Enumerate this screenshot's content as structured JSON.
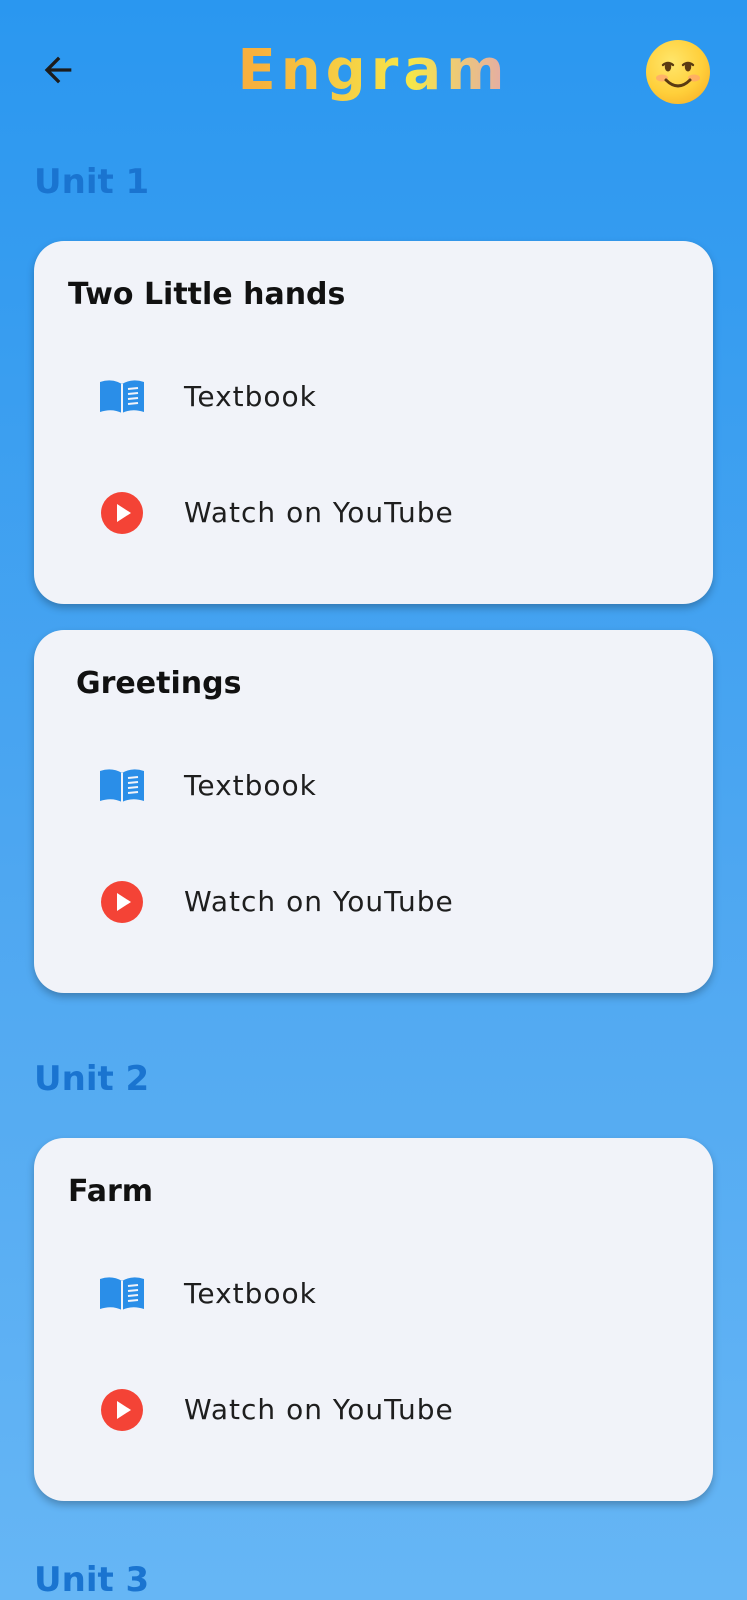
{
  "app": {
    "title": "Engram",
    "back_icon": "arrow-left-icon",
    "avatar_icon": "smiling-face-icon"
  },
  "colors": {
    "background_top": "#2a97f0",
    "background_bottom": "#66b6f5",
    "unit_heading": "#1a74d0",
    "card_background": "#f1f3f9",
    "textbook_icon": "#2a8ee8",
    "youtube_icon": "#f44336"
  },
  "units": [
    {
      "heading": "Unit 1",
      "lessons": [
        {
          "title": "Two Little hands",
          "textbook_label": "Textbook",
          "youtube_label": "Watch on YouTube"
        },
        {
          "title": "Greetings",
          "textbook_label": "Textbook",
          "youtube_label": "Watch on YouTube"
        }
      ]
    },
    {
      "heading": "Unit 2",
      "lessons": [
        {
          "title": "Farm",
          "textbook_label": "Textbook",
          "youtube_label": "Watch on YouTube"
        }
      ]
    },
    {
      "heading": "Unit 3",
      "lessons": []
    }
  ],
  "row_icons": {
    "textbook": "open-book-icon",
    "youtube": "play-circle-icon"
  }
}
